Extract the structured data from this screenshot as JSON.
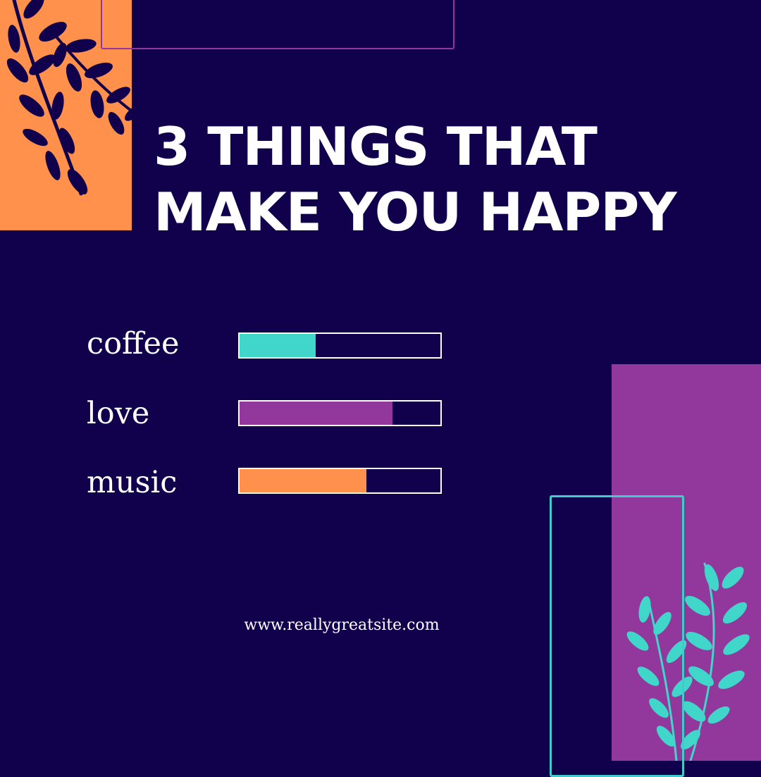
{
  "title": {
    "line1": "3 THINGS THAT",
    "line2": "MAKE YOU HAPPY"
  },
  "items": [
    {
      "label": "coffee",
      "level": 0.38,
      "color": "#40d6c9"
    },
    {
      "label": "love",
      "level": 0.76,
      "color": "#92379c"
    },
    {
      "label": "music",
      "level": 0.63,
      "color": "#ff914d"
    }
  ],
  "footer": {
    "website": "www.reallygreatsite.com"
  },
  "colors": {
    "background": "#11004b",
    "orange": "#ff914d",
    "purple": "#92379c",
    "teal": "#40cccb",
    "white": "#ffffff"
  },
  "icons": {
    "top_left_decoration": "leafy-branch-icon",
    "bottom_right_decoration": "leafy-branch-icon"
  }
}
